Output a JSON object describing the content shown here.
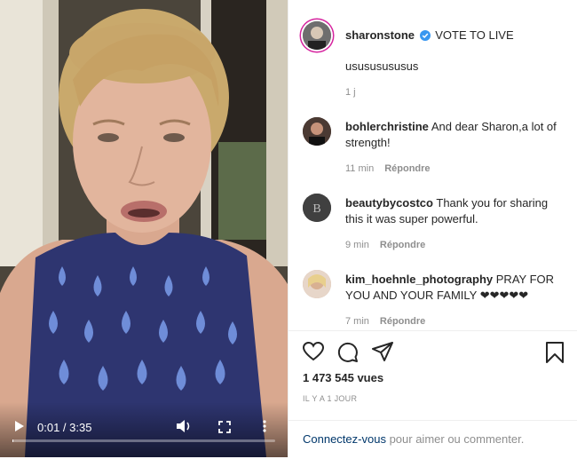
{
  "video": {
    "current_time": "0:01",
    "separator": " / ",
    "duration": "3:35",
    "progress_fraction": 0.005
  },
  "post": {
    "author": "sharonstone",
    "verified": true,
    "caption": "VOTE TO LIVE",
    "caption_line2": "usususususus",
    "age": "1 j"
  },
  "comments": [
    {
      "user": "bohlerchristine",
      "text": "And dear Sharon,a lot of strength!",
      "time": "11 min",
      "reply": "Répondre",
      "avatar_color": "#3b2a24"
    },
    {
      "user": "beautybycostco",
      "text": "Thank you for sharing this it was super powerful.",
      "time": "9 min",
      "reply": "Répondre",
      "avatar_color": "#3a3a3a"
    },
    {
      "user": "kim_hoehnle_photography",
      "text": "PRAY FOR YOU AND YOUR FAMILY ❤❤❤❤❤",
      "time": "7 min",
      "reply": "Répondre",
      "avatar_color": "#c9a48e"
    }
  ],
  "stats": {
    "views": "1 473 545 vues",
    "posted_ago": "IL Y A 1 JOUR"
  },
  "login": {
    "link": "Connectez-vous",
    "rest": " pour aimer ou commenter."
  },
  "colors": {
    "verified_blue": "#3897f0",
    "link_blue": "#00376b",
    "muted": "#8e8e8e"
  }
}
